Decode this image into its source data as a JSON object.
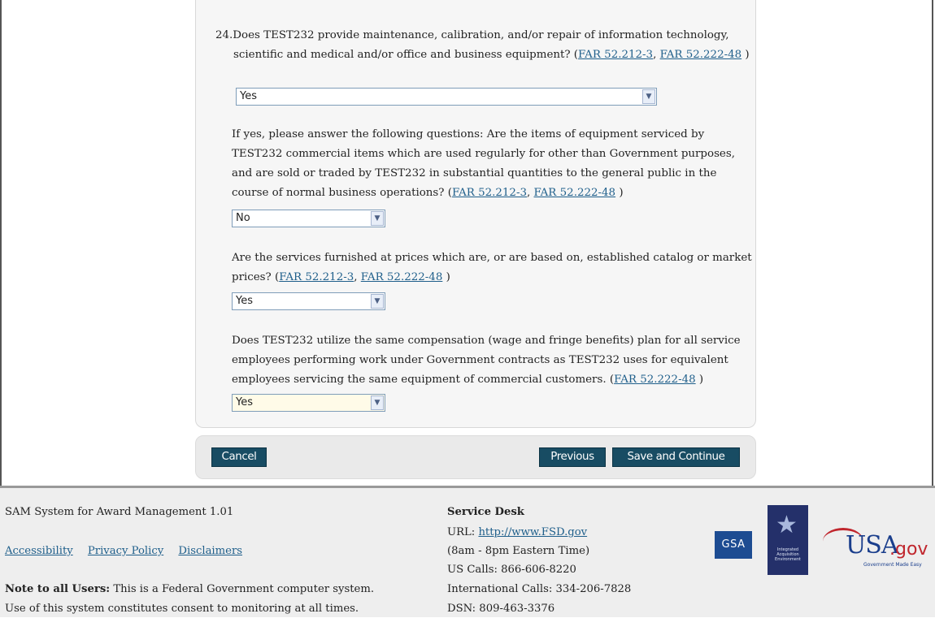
{
  "questions": {
    "q24": {
      "number": "24.",
      "text_lead": "Does TEST232 provide maintenance, calibration, and/or repair of information technology,",
      "text_rest": "scientific and medical and/or office and business equipment? (",
      "link1": "FAR 52.212-3",
      "sep": ", ",
      "link2": "FAR 52.222-48",
      "close": " )",
      "selected": "Yes"
    },
    "commercial_items": {
      "text": "If yes, please answer the following questions: Are the items of equipment serviced by TEST232 commercial items which are used regularly for other than Government purposes, and are sold or traded by TEST232 in substantial quantities to the general public in the course of normal business operations? (",
      "link1": "FAR 52.212-3",
      "sep": ", ",
      "link2": "FAR 52.222-48",
      "close": " )",
      "selected": "No"
    },
    "catalog_prices": {
      "text": "Are the services furnished at prices which are, or are based on, established catalog or market prices? (",
      "link1": "FAR 52.212-3",
      "sep": ", ",
      "link2": "FAR 52.222-48",
      "close": " )",
      "selected": "Yes"
    },
    "compensation": {
      "text": "Does TEST232 utilize the same compensation (wage and fringe benefits) plan for all service employees performing work under Government contracts as TEST232 uses for equivalent employees servicing the same equipment of commercial customers. (",
      "link": "FAR 52.222-48",
      "close": " )",
      "selected": "Yes"
    }
  },
  "actions": {
    "cancel": "Cancel",
    "previous": "Previous",
    "save_continue": "Save and Continue"
  },
  "footer": {
    "system_name": "SAM System for Award Management 1.01",
    "links": [
      "Accessibility",
      "Privacy Policy",
      "Disclaimers"
    ],
    "note_label": "Note to all Users:",
    "note_text": " This is a Federal Government computer system.",
    "note_text2": "Use of this system constitutes consent to monitoring at all times.",
    "service_desk": {
      "title": "Service Desk",
      "url_label": "URL: ",
      "url": "http://www.FSD.gov",
      "hours": "(8am - 8pm Eastern Time)",
      "us_calls": "US Calls: 866-606-8220",
      "intl_calls": "International Calls: 334-206-7828",
      "dsn": "DSN: 809-463-3376"
    },
    "logos": {
      "gsa": "GSA",
      "iae": "Integrated Acquisition Environment",
      "usa": "USA",
      "gov": ".gov",
      "usa_tag": "Government Made Easy"
    }
  }
}
